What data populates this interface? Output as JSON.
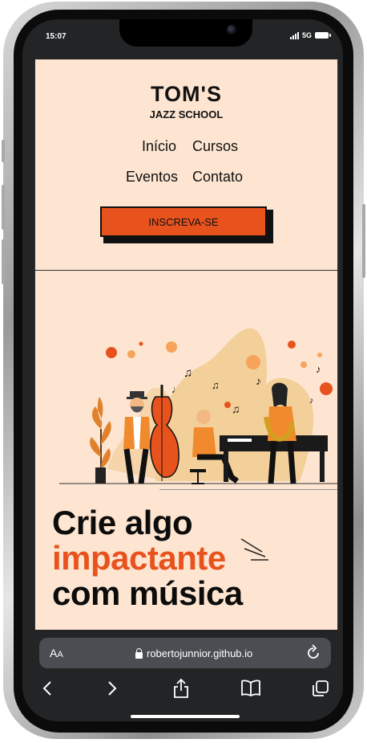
{
  "status": {
    "time": "15:07",
    "network": "5G"
  },
  "site": {
    "logo_title": "TOM'S",
    "logo_subtitle": "JAZZ SCHOOL",
    "nav": [
      "Início",
      "Cursos",
      "Eventos",
      "Contato"
    ],
    "cta_label": "INSCREVA-SE",
    "headline_line1": "Crie algo",
    "headline_line2": "impactante",
    "headline_line3": "com música"
  },
  "browser": {
    "text_size_label": "A",
    "text_size_label_small": "A",
    "url": "robertojunnior.github.io"
  },
  "colors": {
    "background": "#fde5d1",
    "accent": "#e8521d",
    "text": "#111111",
    "browser_chrome": "#222426"
  },
  "icons": [
    "lock-icon",
    "reload-icon",
    "back-arrow-icon",
    "forward-arrow-icon",
    "share-icon",
    "bookmarks-icon",
    "tabs-icon"
  ]
}
